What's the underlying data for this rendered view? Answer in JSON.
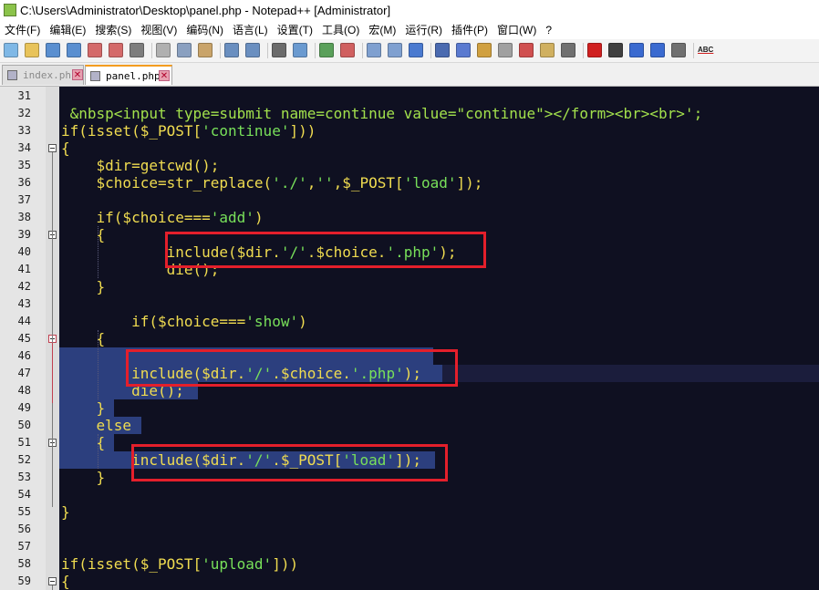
{
  "window": {
    "title": "C:\\Users\\Administrator\\Desktop\\panel.php - Notepad++ [Administrator]"
  },
  "menu": [
    "文件(F)",
    "编辑(E)",
    "搜索(S)",
    "视图(V)",
    "编码(N)",
    "语言(L)",
    "设置(T)",
    "工具(O)",
    "宏(M)",
    "运行(R)",
    "插件(P)",
    "窗口(W)",
    "?"
  ],
  "toolbar": {
    "icons": [
      "new-file-icon",
      "open-file-icon",
      "save-icon",
      "save-all-icon",
      "close-icon",
      "close-all-icon",
      "print-icon",
      "cut-icon",
      "copy-icon",
      "paste-icon",
      "undo-icon",
      "redo-icon",
      "find-icon",
      "replace-icon",
      "zoom-in-icon",
      "zoom-out-icon",
      "sync-vertical-icon",
      "sync-horizontal-icon",
      "word-wrap-icon",
      "show-all-chars-icon",
      "indent-guide-icon",
      "udl-icon",
      "doc-map-icon",
      "function-list-icon",
      "folder-workspace-icon",
      "monitor-icon",
      "record-macro-icon",
      "stop-macro-icon",
      "play-macro-icon",
      "run-macro-multiple-icon",
      "save-macro-icon",
      "spellcheck-icon"
    ],
    "spellcheck_label": "ABC"
  },
  "tabs": [
    {
      "label": "index.php",
      "active": false
    },
    {
      "label": "panel.php",
      "active": true
    }
  ],
  "editor": {
    "line_numbers": [
      "31",
      "32",
      "33",
      "34",
      "35",
      "36",
      "37",
      "38",
      "39",
      "40",
      "41",
      "42",
      "43",
      "44",
      "45",
      "46",
      "47",
      "48",
      "49",
      "50",
      "51",
      "52",
      "53",
      "54",
      "55",
      "56",
      "57",
      "58",
      "59"
    ],
    "lines": [
      {
        "n": "31",
        "segments": []
      },
      {
        "n": "32",
        "segments": [
          {
            "t": " &nbsp<input type=submit name=continue value=\"continue\"></form><br><br>';",
            "c": "lime"
          }
        ]
      },
      {
        "n": "33",
        "segments": [
          {
            "t": "if(isset($_POST[",
            "c": "yellow"
          },
          {
            "t": "'continue'",
            "c": "green"
          },
          {
            "t": "]))",
            "c": "yellow"
          }
        ]
      },
      {
        "n": "34",
        "segments": [
          {
            "t": "{",
            "c": "yellow"
          }
        ]
      },
      {
        "n": "35",
        "segments": [
          {
            "t": "    $dir=getcwd();",
            "c": "yellow"
          }
        ]
      },
      {
        "n": "36",
        "segments": [
          {
            "t": "    $choice=str_replace(",
            "c": "yellow"
          },
          {
            "t": "'./'",
            "c": "green"
          },
          {
            "t": ",",
            "c": "yellow"
          },
          {
            "t": "''",
            "c": "green"
          },
          {
            "t": ",$_POST[",
            "c": "yellow"
          },
          {
            "t": "'load'",
            "c": "green"
          },
          {
            "t": "]);",
            "c": "yellow"
          }
        ]
      },
      {
        "n": "37",
        "segments": []
      },
      {
        "n": "38",
        "segments": [
          {
            "t": "    if($choice===",
            "c": "yellow"
          },
          {
            "t": "'add'",
            "c": "green"
          },
          {
            "t": ")",
            "c": "yellow"
          }
        ]
      },
      {
        "n": "39",
        "segments": [
          {
            "t": "    {",
            "c": "yellow"
          }
        ]
      },
      {
        "n": "40",
        "segments": [
          {
            "t": "            include($dir.",
            "c": "yellow"
          },
          {
            "t": "'/'",
            "c": "green"
          },
          {
            "t": ".$choice.",
            "c": "yellow"
          },
          {
            "t": "'.php'",
            "c": "green"
          },
          {
            "t": ");",
            "c": "yellow"
          }
        ]
      },
      {
        "n": "41",
        "segments": [
          {
            "t": "            die();",
            "c": "yellow"
          }
        ]
      },
      {
        "n": "42",
        "segments": [
          {
            "t": "    }",
            "c": "yellow"
          }
        ]
      },
      {
        "n": "43",
        "segments": []
      },
      {
        "n": "44",
        "segments": [
          {
            "t": "        if($choice===",
            "c": "yellow"
          },
          {
            "t": "'show'",
            "c": "green"
          },
          {
            "t": ")",
            "c": "yellow"
          }
        ]
      },
      {
        "n": "45",
        "segments": [
          {
            "t": "    {",
            "c": "yellow"
          }
        ]
      },
      {
        "n": "46",
        "segments": []
      },
      {
        "n": "47",
        "segments": [
          {
            "t": "        include($dir.",
            "c": "yellow"
          },
          {
            "t": "'/'",
            "c": "green"
          },
          {
            "t": ".$choice.",
            "c": "yellow"
          },
          {
            "t": "'.php'",
            "c": "green"
          },
          {
            "t": ");",
            "c": "yellow"
          }
        ]
      },
      {
        "n": "48",
        "segments": [
          {
            "t": "        die();",
            "c": "yellow"
          }
        ]
      },
      {
        "n": "49",
        "segments": [
          {
            "t": "    }",
            "c": "yellow"
          }
        ]
      },
      {
        "n": "50",
        "segments": [
          {
            "t": "    else",
            "c": "yellow"
          }
        ]
      },
      {
        "n": "51",
        "segments": [
          {
            "t": "    {",
            "c": "yellow"
          }
        ]
      },
      {
        "n": "52",
        "segments": [
          {
            "t": "        include($dir.",
            "c": "yellow"
          },
          {
            "t": "'/'",
            "c": "green"
          },
          {
            "t": ".$_POST[",
            "c": "yellow"
          },
          {
            "t": "'load'",
            "c": "green"
          },
          {
            "t": "]);",
            "c": "yellow"
          }
        ]
      },
      {
        "n": "53",
        "segments": [
          {
            "t": "    }",
            "c": "yellow"
          }
        ]
      },
      {
        "n": "54",
        "segments": []
      },
      {
        "n": "55",
        "segments": [
          {
            "t": "}",
            "c": "yellow"
          }
        ]
      },
      {
        "n": "56",
        "segments": []
      },
      {
        "n": "57",
        "segments": []
      },
      {
        "n": "58",
        "segments": [
          {
            "t": "if(isset($_POST[",
            "c": "yellow"
          },
          {
            "t": "'upload'",
            "c": "green"
          },
          {
            "t": "]))",
            "c": "yellow"
          }
        ]
      },
      {
        "n": "59",
        "segments": [
          {
            "t": "{",
            "c": "yellow"
          }
        ]
      }
    ]
  },
  "colors": {
    "background": "#0f1021",
    "keyword": "#f0dc50",
    "string": "#78e05a",
    "html": "#a2e04c",
    "selection": "#2c3f7e",
    "highlight_box": "#e41f2b"
  }
}
